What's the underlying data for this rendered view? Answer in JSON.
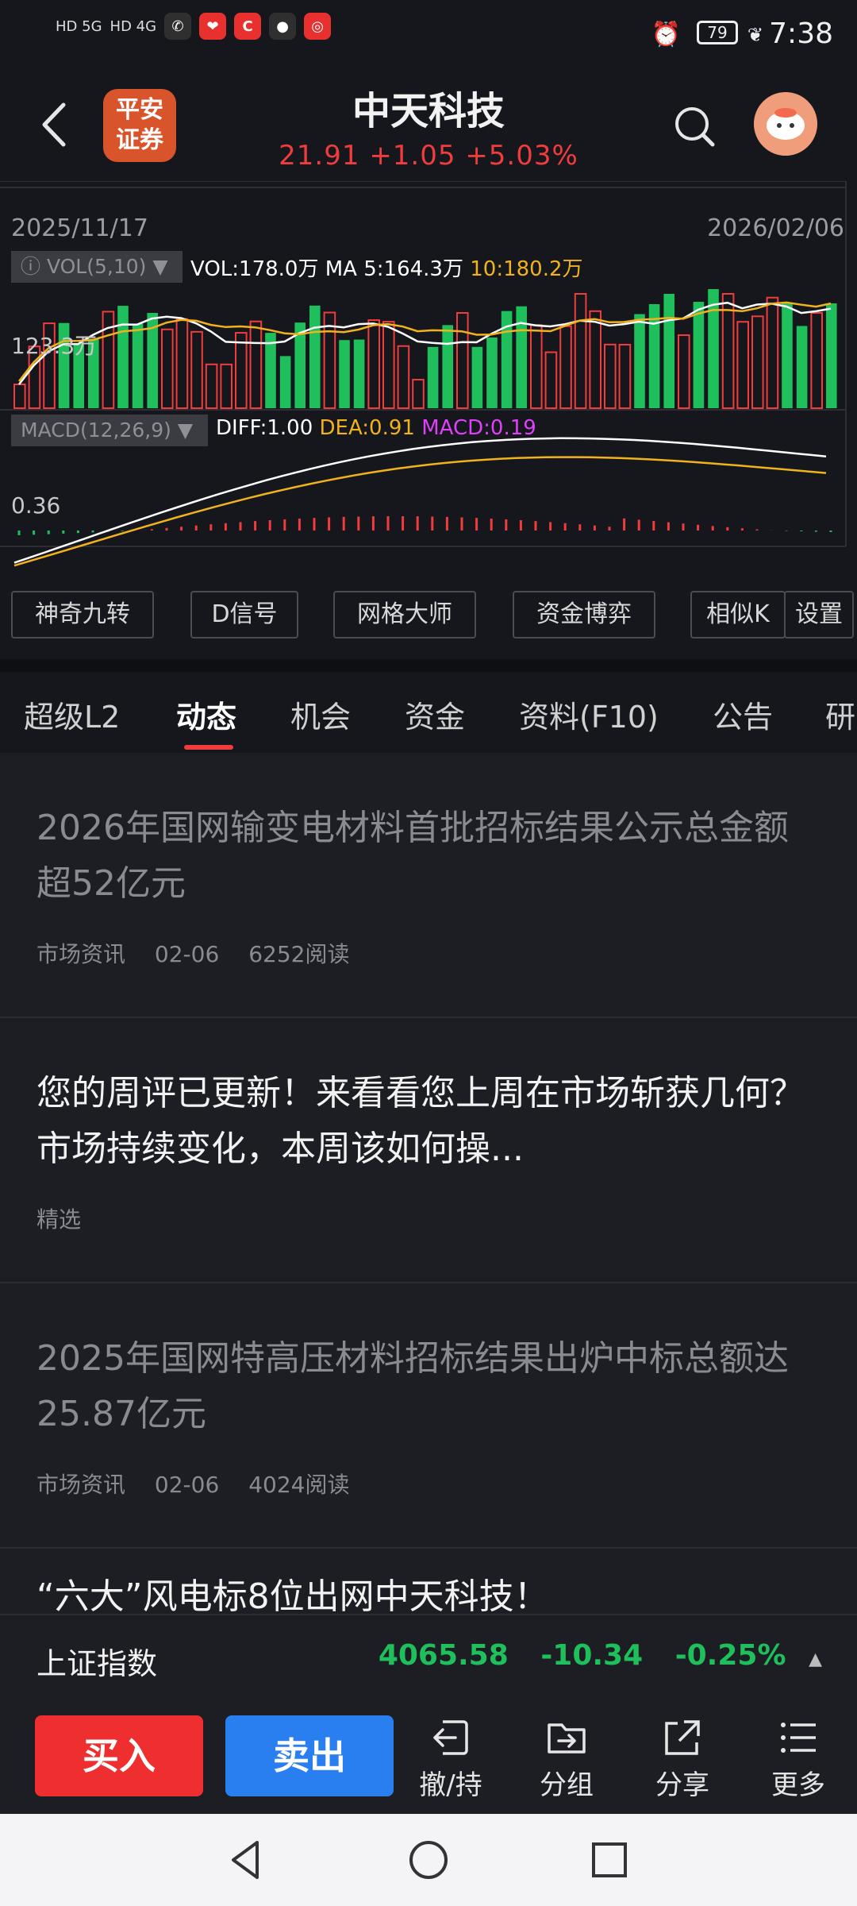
{
  "status_bar": {
    "network_1": "HD 5G",
    "network_2": "HD 4G",
    "battery": "79",
    "time": "7:38"
  },
  "header": {
    "broker_logo_text": "平安证券",
    "stock_name": "中天科技",
    "quote": "21.91 +1.05 +5.03%",
    "icons": [
      "back-arrow-icon",
      "search-icon",
      "avatar"
    ]
  },
  "chart": {
    "date_start": "2025/11/17",
    "date_end": "2026/02/06",
    "volume_indicator": "VOL(5,10)",
    "volume_readout": "VOL:178.0万 MA 5:164.3万",
    "volume_ma10": "10:180.2万",
    "volume_max_label": "123.3万",
    "macd_indicator": "MACD(12,26,9)",
    "diff": "DIFF:1.00",
    "dea": "DEA:0.91",
    "macd": "MACD:0.19",
    "macd_max_label": "0.36",
    "colors": {
      "up": "#f03c3c",
      "down": "#1fbf5c",
      "ma5": "#ffffff",
      "ma10": "#f2b21c"
    }
  },
  "tools": [
    "神奇九转",
    "D信号",
    "网格大师",
    "资金博弈",
    "相似K",
    "设置"
  ],
  "tabs": [
    "超级L2",
    "动态",
    "机会",
    "资金",
    "资料(F10)",
    "公告",
    "研"
  ],
  "active_tab": "动态",
  "news": [
    {
      "title": "2026年国网输变电材料首批招标结果公示总金额超52亿元",
      "source": "市场资讯",
      "date": "02-06",
      "reads": "6252阅读",
      "read": true
    },
    {
      "title": "您的周评已更新！来看看您上周在市场斩获几何？市场持续变化，本周该如何操...",
      "source": "精选",
      "read": false
    },
    {
      "title": "2025年国网特高压材料招标结果出炉中标总额达25.87亿元",
      "source": "市场资讯",
      "date": "02-06",
      "reads": "4024阅读",
      "read": true
    },
    {
      "title": "“六大”风电标8位出网中天科技！"
    }
  ],
  "index_bar": {
    "name": "上证指数",
    "value": "4065.58",
    "change": "-10.34",
    "change_pct": "-0.25%"
  },
  "actions": {
    "buy": "买入",
    "sell": "卖出",
    "items": [
      "撤/持",
      "分组",
      "分享",
      "更多"
    ]
  }
}
